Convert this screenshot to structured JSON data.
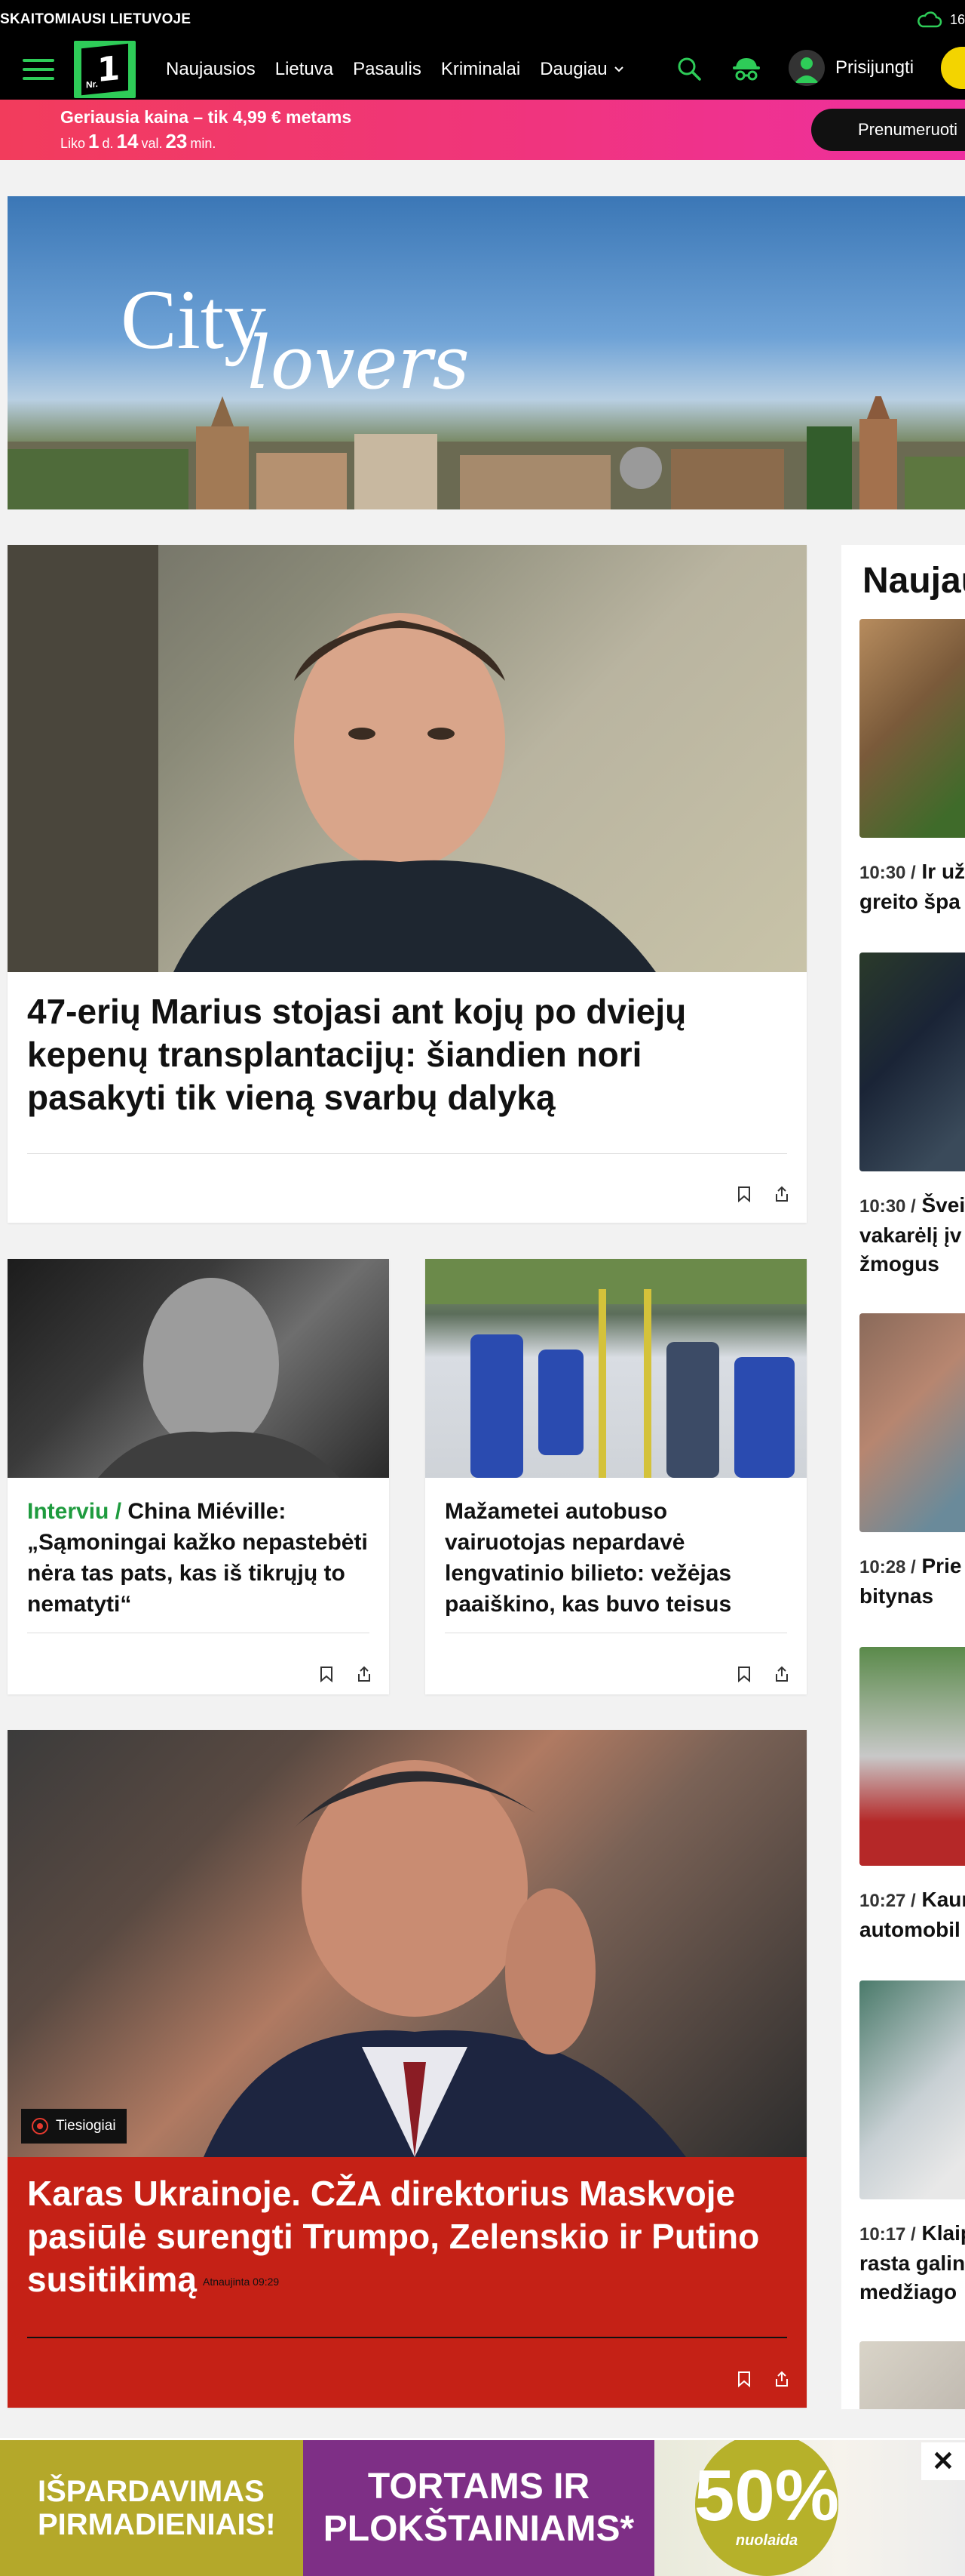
{
  "topbar": {
    "tagline": "SKAITOMIAUSI LIETUVOJE",
    "weather_temp": "16"
  },
  "nav": {
    "logo_small": "Nr.",
    "logo_big": "1",
    "menu": [
      "Naujausios",
      "Lietuva",
      "Pasaulis",
      "Kriminalai",
      "Daugiau"
    ],
    "login_label": "Prisijungti"
  },
  "promo": {
    "price_text": "Geriausia kaina – tik 4,99 € metams",
    "left_prefix": "Liko",
    "days": "1",
    "days_unit": "d.",
    "hours": "14",
    "hours_unit": "val.",
    "minutes": "23",
    "minutes_unit": "min.",
    "subscribe_label": "Prenumeruoti"
  },
  "banner": {
    "word1": "City",
    "word2": "lovers"
  },
  "articles": {
    "main": {
      "title": "47-erių Marius stojasi ant kojų po dviejų kepenų transplantacijų: šiandien nori pasakyti tik vieną svarbų dalyką"
    },
    "small1": {
      "kicker": "Interviu /",
      "title": " China Miéville: „Sąmoningai kažko nepastebėti nėra tas pats, kas iš tikrųjų to nematyti“"
    },
    "small2": {
      "title": "Mažametei autobuso vairuotojas nepardavė lengvatinio bilieto: vežėjas paaiškino, kas buvo teisus"
    },
    "live": {
      "badge": "Tiesiogiai",
      "title": "Karas Ukrainoje. CŽA direktorius Maskvoje pasiūlė surengti Trumpo, Zelenskio ir Putino susitikimą",
      "updated": "Atnaujinta 09:29"
    }
  },
  "sidebar": {
    "title": "Naujausios",
    "items": [
      {
        "time": "10:30 /",
        "lines": [
          "Ir už",
          "greito špa"
        ]
      },
      {
        "time": "10:30 /",
        "lines": [
          "Švei",
          "vakarėlį įv",
          "žmogus"
        ]
      },
      {
        "time": "10:28 /",
        "lines": [
          "Prie",
          "bitynas"
        ]
      },
      {
        "time": "10:27 /",
        "lines": [
          "Kaun",
          "automobil"
        ]
      },
      {
        "time": "10:17 /",
        "lines": [
          "Klaip",
          "rasta galin",
          "medžiago"
        ]
      }
    ]
  },
  "ad": {
    "panel1": [
      "IŠPARDAVIMAS",
      "PIRMADIENIAIS!"
    ],
    "panel2": [
      "TORTAMS IR",
      "PLOKŠTAINIAMS*"
    ],
    "panel3_pct": "50%",
    "panel3_label": "nuolaida",
    "close": "✕"
  },
  "colors": {
    "brand_green": "#2ecc58",
    "live_red": "#c52116",
    "promo_pink": "#f0357a",
    "subscribe_yellow": "#f3d400"
  }
}
